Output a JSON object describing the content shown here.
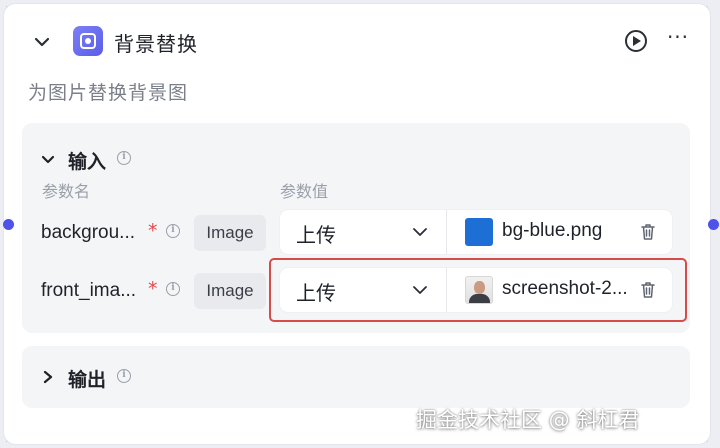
{
  "node": {
    "title": "背景替换",
    "description": "为图片替换背景图",
    "icons": {
      "node": "image-replace-icon",
      "run": "play-circle-icon",
      "more": "more-horizontal-icon",
      "collapse": "chevron-down-icon"
    },
    "more_label": "···"
  },
  "input_section": {
    "title": "输入",
    "col_name": "参数名",
    "col_value": "参数值",
    "params": [
      {
        "name": "backgrou...",
        "required_mark": "*",
        "type": "Image",
        "source": "上传",
        "filename": "bg-blue.png",
        "thumb": "blue-square"
      },
      {
        "name": "front_ima...",
        "required_mark": "*",
        "type": "Image",
        "source": "上传",
        "filename": "screenshot-2...",
        "thumb": "portrait-photo"
      }
    ]
  },
  "output_section": {
    "title": "输出"
  },
  "watermark": "掘金技术社区 @ 斜杠君",
  "colors": {
    "accent": "#4d53e8",
    "highlight_border": "#d94a4a",
    "required": "#e5484d"
  }
}
